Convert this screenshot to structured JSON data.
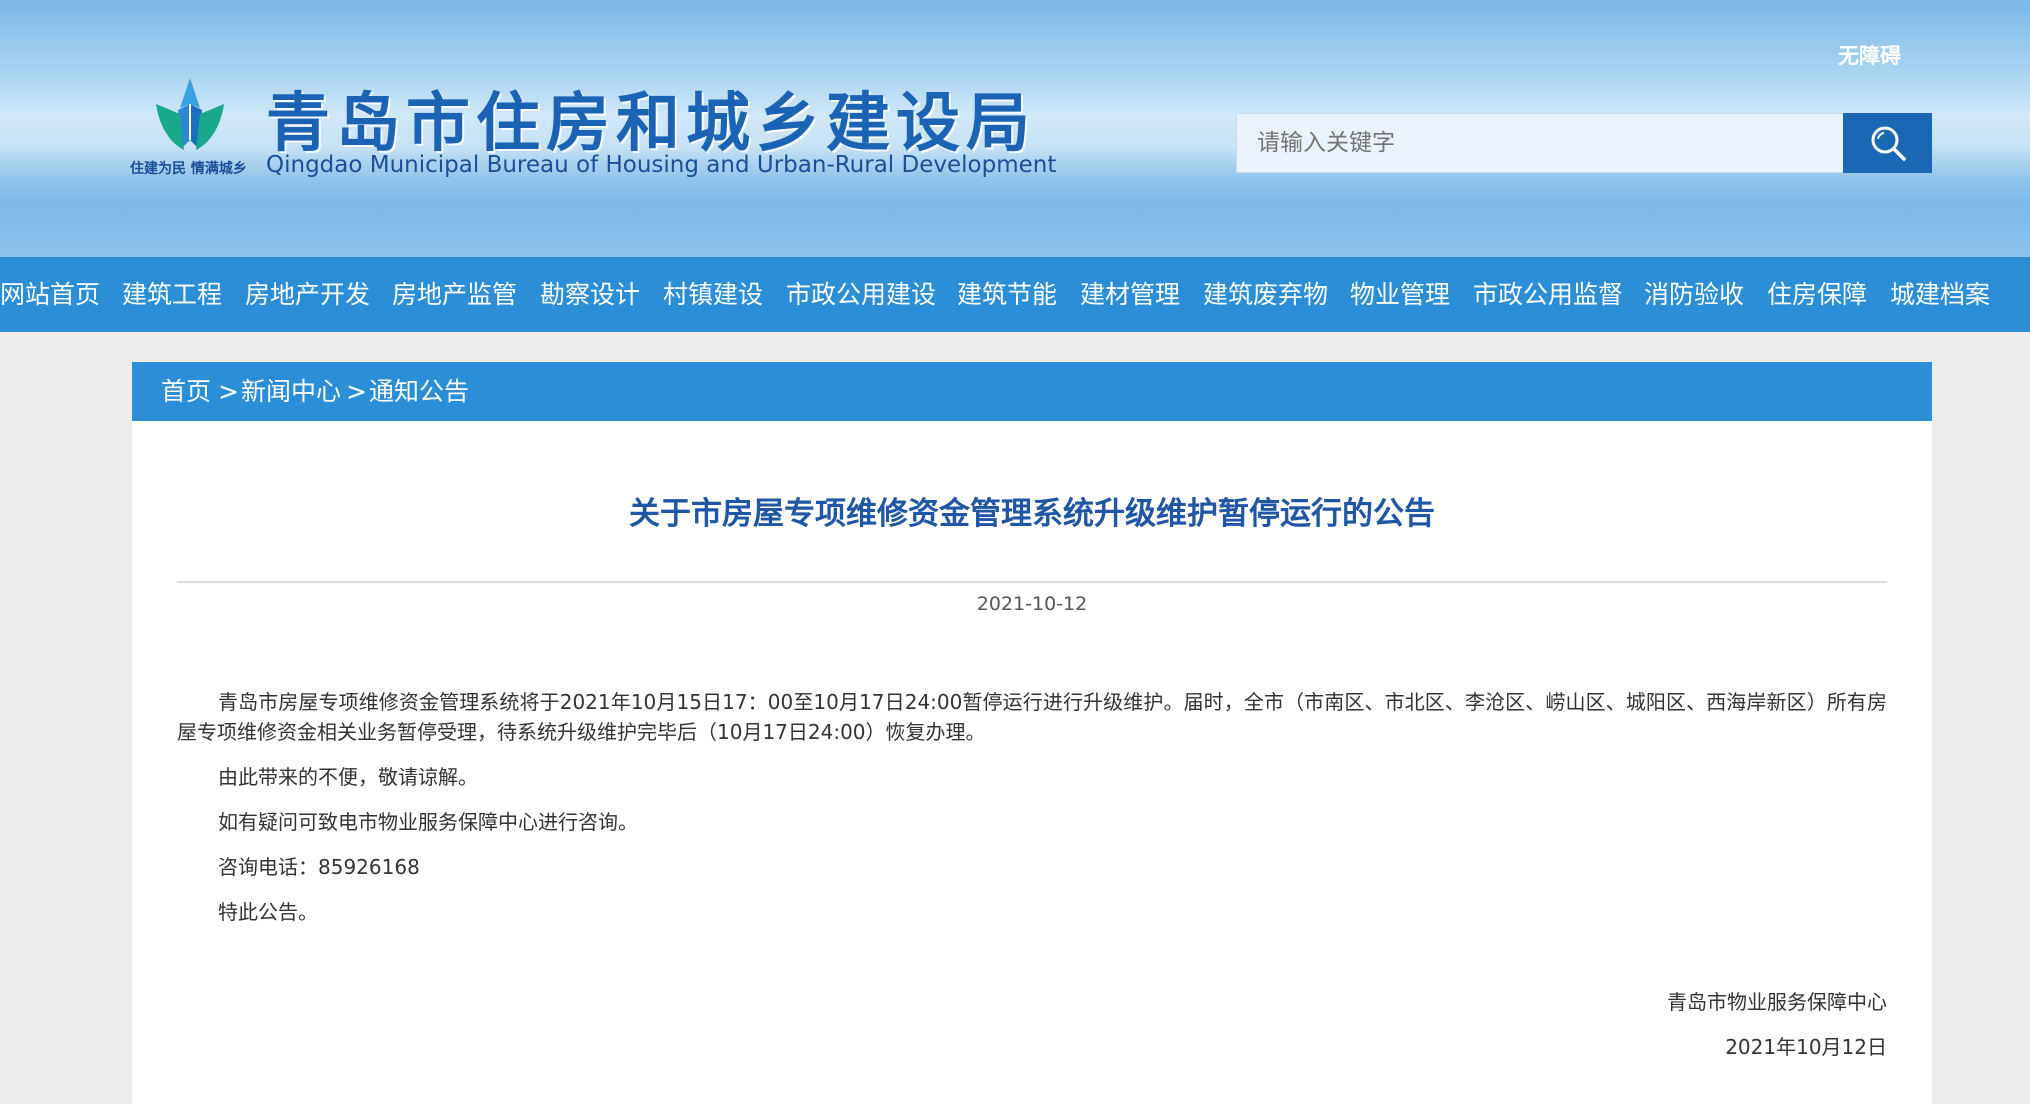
{
  "header": {
    "slogan": "住建为民 情满城乡",
    "title_cn": "青岛市住房和城乡建设局",
    "title_en": "Qingdao Municipal Bureau of Housing and Urban-Rural Development",
    "accessibility_label": "无障碍",
    "search_placeholder": "请输入关键字",
    "search_icon": "search-icon"
  },
  "nav": {
    "items": [
      {
        "label": "网站首页"
      },
      {
        "label": "建筑工程"
      },
      {
        "label": "房地产开发"
      },
      {
        "label": "房地产监管"
      },
      {
        "label": "勘察设计"
      },
      {
        "label": "村镇建设"
      },
      {
        "label": "市政公用建设"
      },
      {
        "label": "建筑节能"
      },
      {
        "label": "建材管理"
      },
      {
        "label": "建筑废弃物"
      },
      {
        "label": "物业管理"
      },
      {
        "label": "市政公用监督"
      },
      {
        "label": "消防验收"
      },
      {
        "label": "住房保障"
      },
      {
        "label": "城建档案"
      }
    ]
  },
  "breadcrumb": {
    "items": [
      "首页",
      "新闻中心",
      "通知公告"
    ],
    "separator": ">"
  },
  "article": {
    "title": "关于市房屋专项维修资金管理系统升级维护暂停运行的公告",
    "date": "2021-10-12",
    "paragraphs": [
      "青岛市房屋专项维修资金管理系统将于2021年10月15日17：00至10月17日24:00暂停运行进行升级维护。届时，全市（市南区、市北区、李沧区、崂山区、城阳区、西海岸新区）所有房屋专项维修资金相关业务暂停受理，待系统升级维护完毕后（10月17日24:00）恢复办理。",
      "由此带来的不便，敬请谅解。",
      "如有疑问可致电市物业服务保障中心进行咨询。",
      "咨询电话：85926168",
      "特此公告。"
    ],
    "signature_org": "青岛市物业服务保障中心",
    "signature_date": "2021年10月12日"
  },
  "colors": {
    "nav_bg": "#2b8ed7",
    "title_blue": "#1f56a6",
    "search_button": "#1a68b3"
  }
}
